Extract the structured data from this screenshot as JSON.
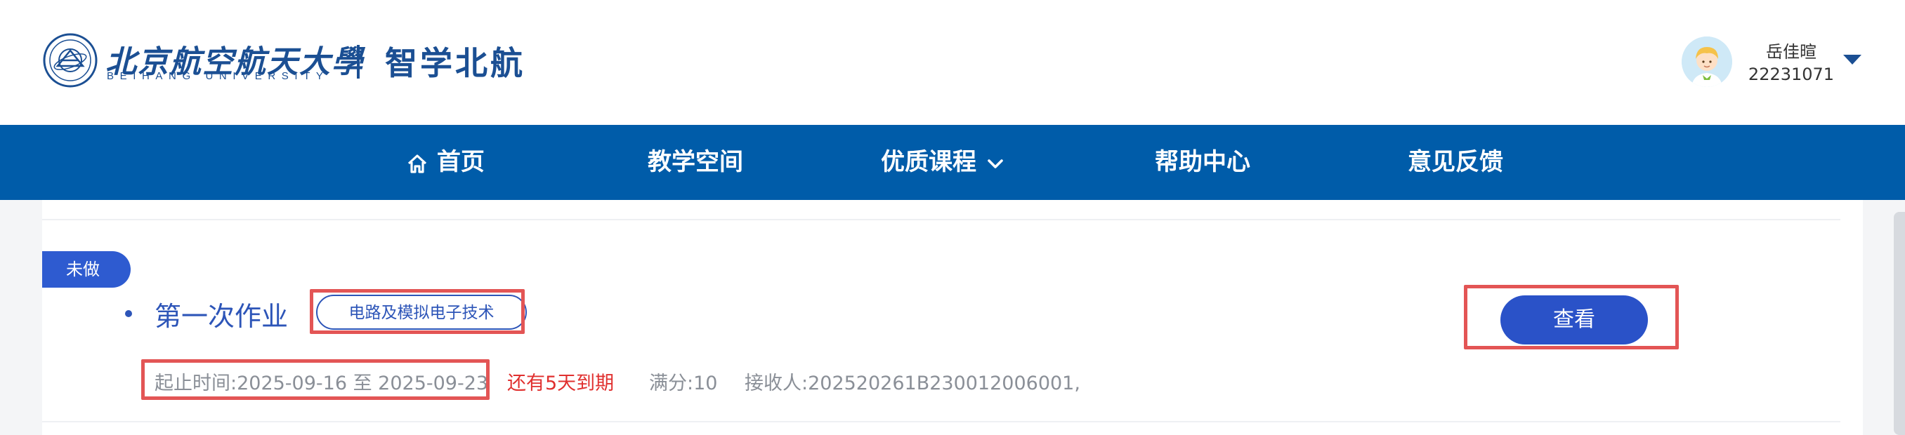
{
  "header": {
    "logo_cn": "北京航空航天大學",
    "logo_en": "BEIHANG UNIVERSITY",
    "site_name": "智学北航",
    "user": {
      "name": "岳佳暄",
      "id": "22231071"
    }
  },
  "nav": {
    "home": "首页",
    "space": "教学空间",
    "courses": "优质课程",
    "help": "帮助中心",
    "feedback": "意见反馈"
  },
  "assignment": {
    "status": "未做",
    "title": "第一次作业",
    "course_tag": "电路及模拟电子技术",
    "time_range": "起止时间:2025-09-16 至 2025-09-23",
    "due_notice": "还有5天到期",
    "full_score": "满分:10",
    "receiver": "接收人:202520261B230012006001,",
    "view_label": "查看"
  },
  "colors": {
    "brand_blue": "#005ca9",
    "logo_blue": "#1b4f93",
    "link_blue": "#2d55b8",
    "button_blue": "#2a52c8",
    "due_red": "#e0302f",
    "highlight_red": "#e35555"
  }
}
